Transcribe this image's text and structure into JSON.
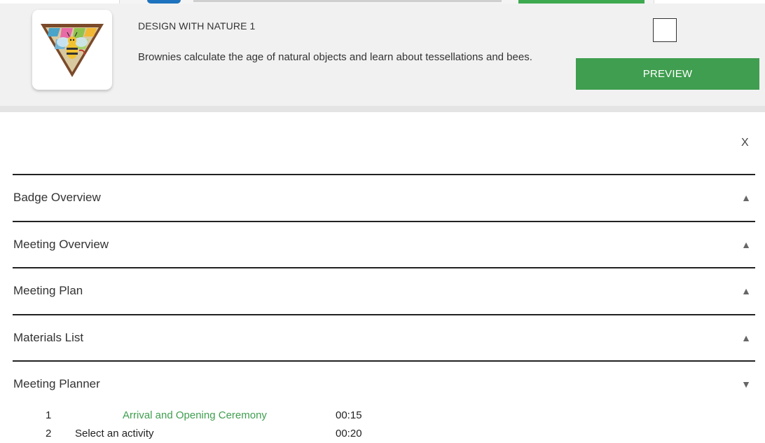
{
  "card": {
    "title": "DESIGN WITH NATURE 1",
    "description": "Brownies calculate the age of natural objects and learn about tessellations and bees.",
    "preview_label": "PREVIEW"
  },
  "close_label": "X",
  "sections": [
    {
      "label": "Badge Overview",
      "arrow": "▲"
    },
    {
      "label": "Meeting Overview",
      "arrow": "▲"
    },
    {
      "label": "Meeting Plan",
      "arrow": "▲"
    },
    {
      "label": "Materials List",
      "arrow": "▲"
    },
    {
      "label": "Meeting Planner",
      "arrow": "▼"
    }
  ],
  "planner": [
    {
      "num": "1",
      "name": "Arrival and Opening Ceremony",
      "time": "00:15"
    },
    {
      "num": "2",
      "name": "Select an activity",
      "time": "00:20"
    }
  ],
  "colors": {
    "accent": "#3f9e4f",
    "card_bg": "#f1f1f1"
  }
}
